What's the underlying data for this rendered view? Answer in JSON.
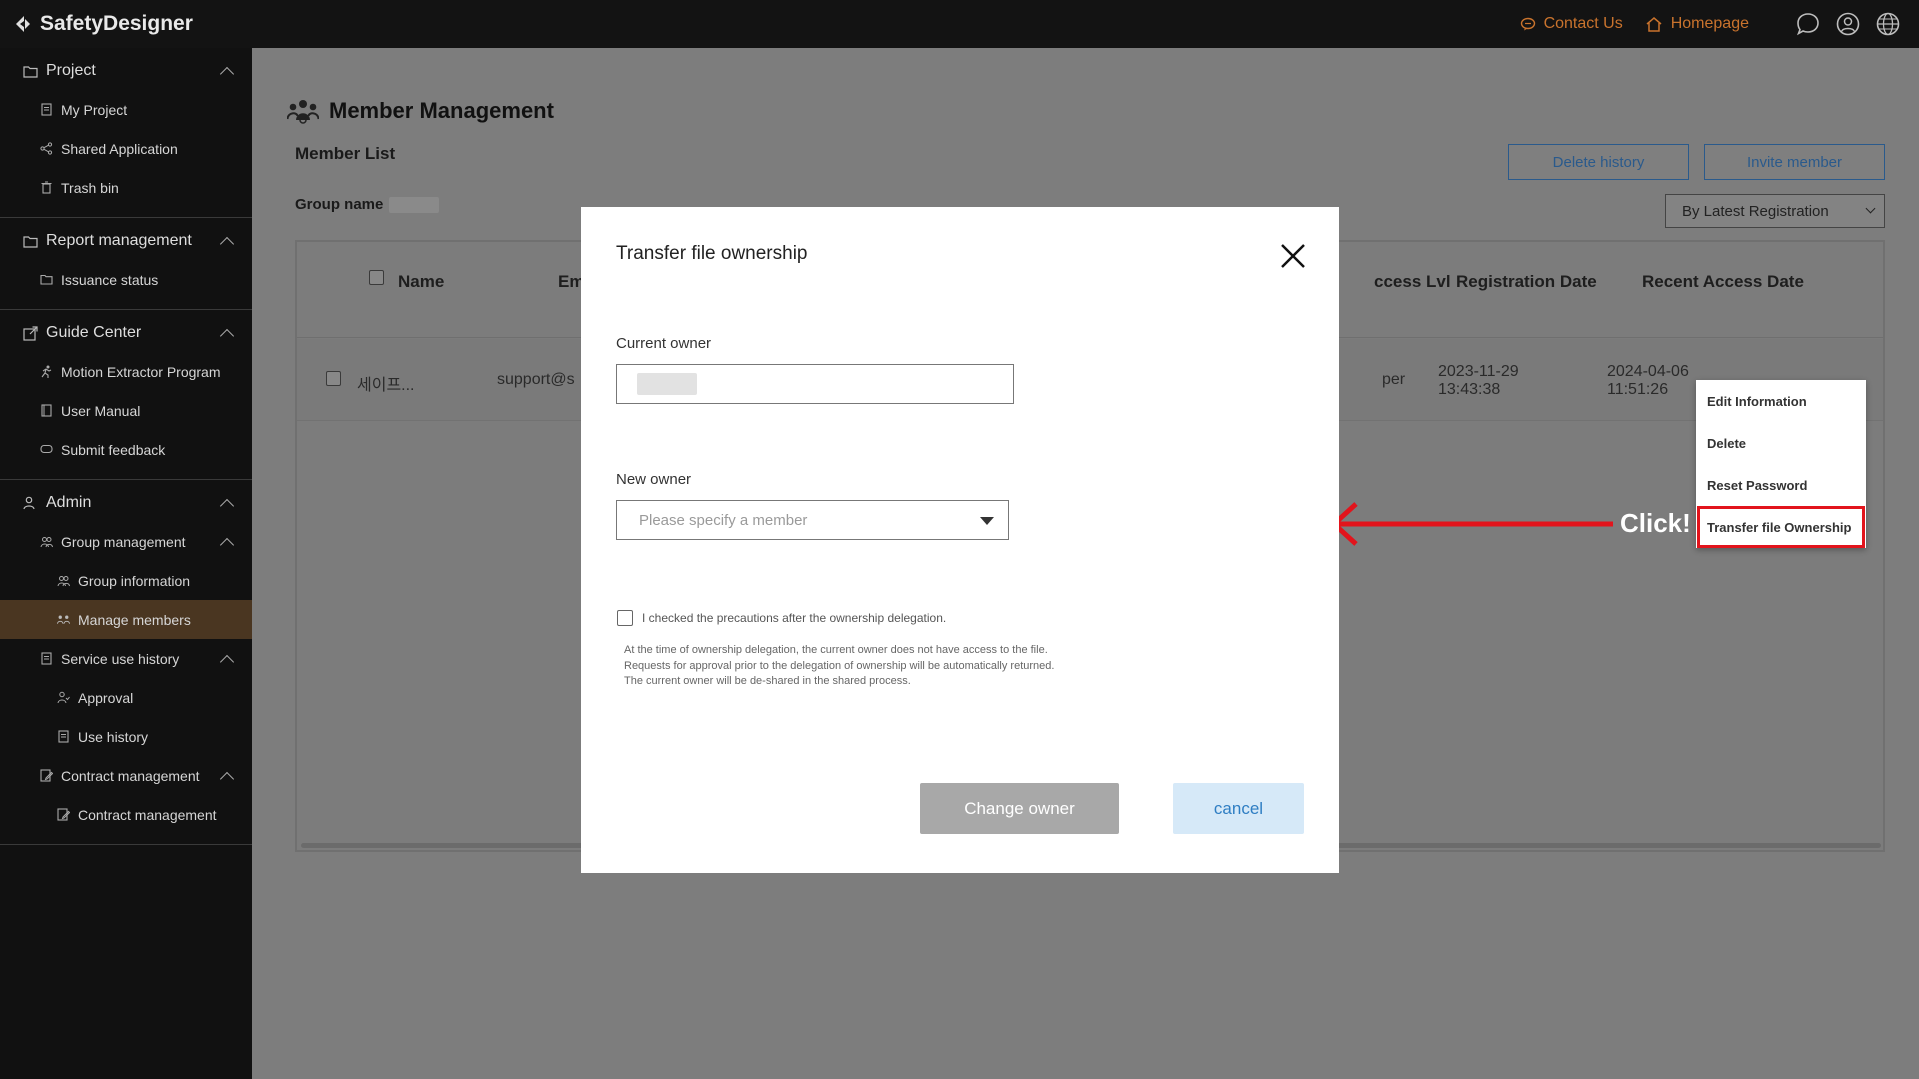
{
  "app": {
    "brand": "SafetyDesigner",
    "top_links": {
      "contact": "Contact Us",
      "homepage": "Homepage"
    },
    "accent_color": "#c9732d",
    "top_icons": [
      "chat-icon",
      "user-icon",
      "globe-icon"
    ]
  },
  "sidebar": {
    "sections": [
      {
        "title": "Project",
        "items": [
          "My Project",
          "Shared Application",
          "Trash bin"
        ]
      },
      {
        "title": "Report management",
        "items": [
          "Issuance status"
        ]
      },
      {
        "title": "Guide Center",
        "items": [
          "Motion Extractor Program",
          "User Manual",
          "Submit feedback"
        ]
      },
      {
        "title": "Admin",
        "items": [
          "Group management",
          "Group information",
          "Manage members",
          "Service use history",
          "Approval",
          "Use history",
          "Contract management",
          "Contract management"
        ]
      }
    ],
    "active_item": "Manage members"
  },
  "page": {
    "title": "Member Management",
    "list_title": "Member List",
    "group_name_label": "Group name",
    "delete_history": "Delete history",
    "invite_member": "Invite member",
    "sort_value": "By Latest Registration"
  },
  "table": {
    "headers": {
      "name": "Name",
      "email": "Em",
      "access": "ccess Lvl",
      "registration": "Registration Date",
      "recent": "Recent Access Date"
    },
    "rows": [
      {
        "name": "세이프...",
        "email": "support@s",
        "access": "per",
        "reg_date": "2023-11-29",
        "reg_time": "13:43:38",
        "acc_date": "2024-04-06",
        "acc_time": "11:51:26"
      }
    ]
  },
  "context_menu": {
    "items": [
      "Edit Information",
      "Delete",
      "Reset Password",
      "Transfer file Ownership"
    ],
    "highlight_color": "#e2141c"
  },
  "annotation": {
    "click_label": "Click!"
  },
  "modal": {
    "title": "Transfer file ownership",
    "current_owner_label": "Current owner",
    "new_owner_label": "New owner",
    "new_owner_placeholder": "Please specify a member",
    "checkbox_label": "I checked the precautions after the ownership delegation.",
    "notes": [
      "At the time of ownership delegation, the current owner does not have access to the file.",
      "Requests for approval prior to the delegation of ownership will be automatically returned.",
      "The current owner will be de-shared in the shared process."
    ],
    "change_owner": "Change owner",
    "cancel": "cancel"
  }
}
